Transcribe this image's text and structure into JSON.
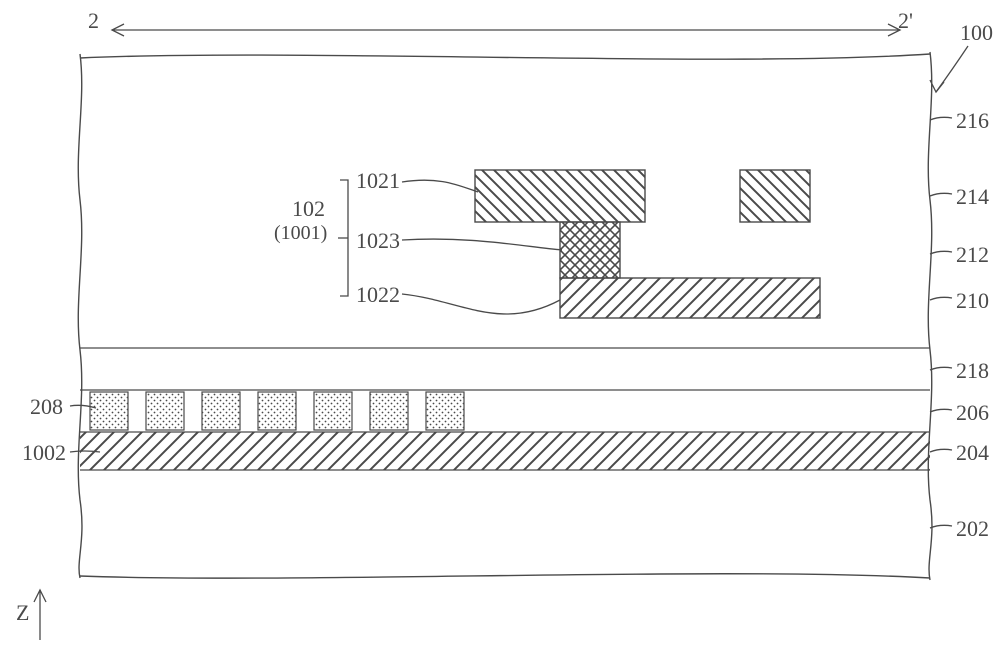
{
  "figure_ref": "100",
  "section_line": {
    "left_mark": "2",
    "right_mark": "2'"
  },
  "axis": {
    "label": "Z"
  },
  "right_layer_refs": [
    "216",
    "214",
    "212",
    "210",
    "218",
    "206",
    "204",
    "202"
  ],
  "left_refs": [
    "208",
    "1002"
  ],
  "group_102": {
    "group_label": "102",
    "group_paren": "(1001)",
    "members": [
      "1021",
      "1023",
      "1022"
    ]
  },
  "chart_data": {
    "type": "diagram",
    "title": "Cross-section 2–2' of device 100",
    "view_axis": "Z (vertical)",
    "stack_top_to_bottom": [
      "216 (top layer / passivation)",
      "214 (layer containing 1021 features)",
      "212 (layer containing 1023 via)",
      "210 (layer containing 1022 plate)",
      "218 (thin layer / interface)",
      "206 (layer containing 208 segmented features)",
      "204 (full-width hatched layer, leader 1002 points here)",
      "202 (substrate / bottom)"
    ],
    "feature_102": {
      "alias": "1001",
      "components_top_to_bottom": [
        "1021",
        "1023",
        "1022"
      ],
      "description": "stacked feature: top hatched pad (1021), cross-hatched via (1023), bottom hatched plate (1022); a second separate hatched pad sits to the right at the 1021 level"
    },
    "feature_208": {
      "description": "row of seven spaced dotted blocks inside layer 206, occupying roughly the left 45% of the width"
    },
    "layer_204": {
      "description": "continuous diagonally-hatched layer spanning full width"
    },
    "boundaries": "left and right edges drawn as wavy break lines; top edge drawn as a gentle curve (a break/continuation)"
  }
}
